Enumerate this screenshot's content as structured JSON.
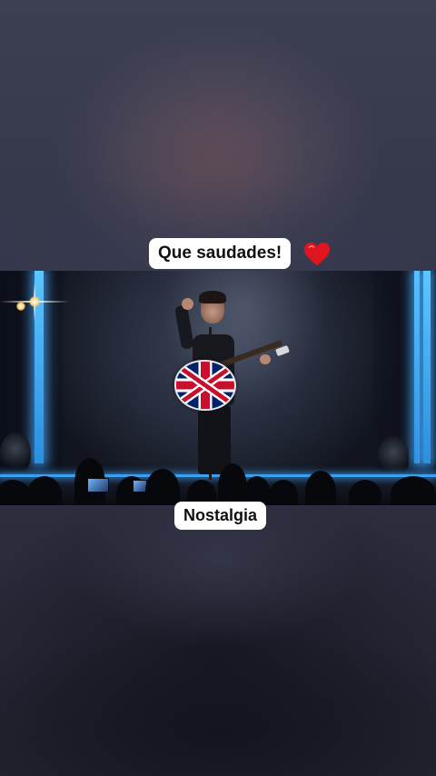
{
  "captions": {
    "top": "Que saudades!",
    "bottom": "Nostalgia"
  },
  "heart_emoji": {
    "icon": "red-heart-icon",
    "color": "#e0141e"
  },
  "video": {
    "scene": "concert-stage",
    "accent_color": "#3aa0ef"
  }
}
